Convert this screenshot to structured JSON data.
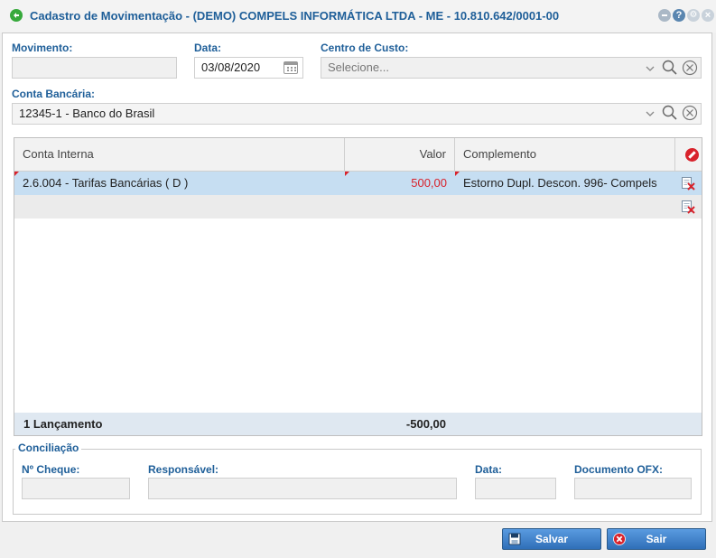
{
  "window": {
    "title": "Cadastro de Movimentação - (DEMO) COMPELS INFORMÁTICA LTDA - ME - 10.810.642/0001-00",
    "title_icon": "back-arrow-icon",
    "buttons": [
      "minimize-icon",
      "help-icon",
      "settings-icon",
      "close-icon"
    ]
  },
  "form": {
    "movimento": {
      "label": "Movimento:",
      "value": ""
    },
    "data": {
      "label": "Data:",
      "value": "03/08/2020"
    },
    "centro_custo": {
      "label": "Centro de Custo:",
      "placeholder": "Selecione..."
    },
    "conta_bancaria": {
      "label": "Conta Bancária:",
      "value": "12345-1 - Banco do Brasil"
    }
  },
  "grid": {
    "columns": [
      "Conta Interna",
      "Valor",
      "Complemento"
    ],
    "rows": [
      {
        "conta": "2.6.004 - Tarifas Bancárias ( D )",
        "valor": "500,00",
        "complemento": "Estorno Dupl. Descon. 996- Compels"
      }
    ],
    "footer": {
      "count": "1 Lançamento",
      "total": "-500,00"
    }
  },
  "conciliacao": {
    "legend": "Conciliação",
    "cheque_label": "Nº Cheque:",
    "responsavel_label": "Responsável:",
    "data_label": "Data:",
    "ofx_label": "Documento OFX:"
  },
  "actions": {
    "save": "Salvar",
    "exit": "Sair"
  },
  "colors": {
    "accent": "#1f5f99",
    "negative": "#d8222b",
    "selected_row": "#c6def2",
    "button": "#3a7dc9"
  }
}
